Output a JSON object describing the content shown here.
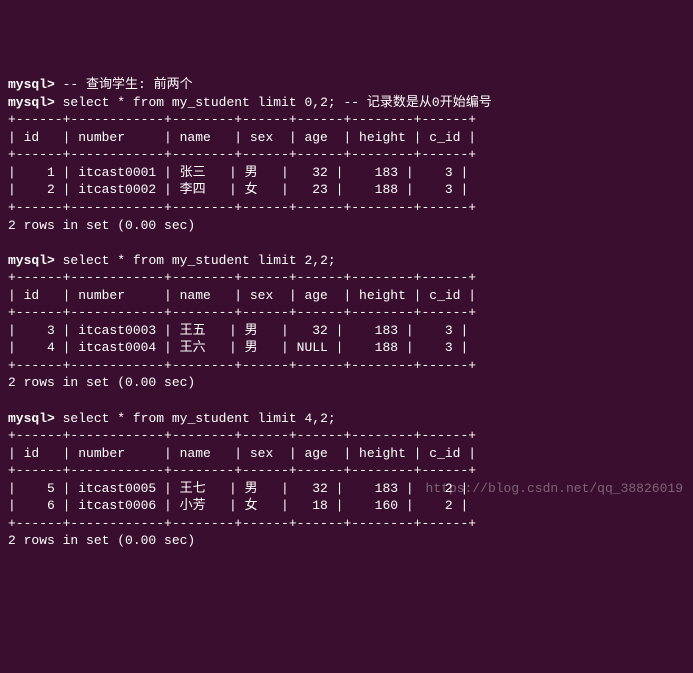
{
  "prompt": "mysql>",
  "block1": {
    "comment_line": "-- 查询学生: 前两个",
    "query": "select * from my_student limit 0,2;",
    "inline_comment": "-- 记录数是从0开始编号",
    "separator": "+------+------------+--------+------+------+--------+------+",
    "header": "| id   | number     | name   | sex  | age  | height | c_id |",
    "rows": [
      "|    1 | itcast0001 | 张三   | 男   |   32 |    183 |    3 |",
      "|    2 | itcast0002 | 李四   | 女   |   23 |    188 |    3 |"
    ],
    "status": "2 rows in set (0.00 sec)"
  },
  "block2": {
    "query": "select * from my_student limit 2,2;",
    "separator": "+------+------------+--------+------+------+--------+------+",
    "header": "| id   | number     | name   | sex  | age  | height | c_id |",
    "rows": [
      "|    3 | itcast0003 | 王五   | 男   |   32 |    183 |    3 |",
      "|    4 | itcast0004 | 王六   | 男   | NULL |    188 |    3 |"
    ],
    "status": "2 rows in set (0.00 sec)"
  },
  "block3": {
    "query": "select * from my_student limit 4,2;",
    "separator": "+------+------------+--------+------+------+--------+------+",
    "header": "| id   | number     | name   | sex  | age  | height | c_id |",
    "rows": [
      "|    5 | itcast0005 | 王七   | 男   |   32 |    183 |    2 |",
      "|    6 | itcast0006 | 小芳   | 女   |   18 |    160 |    2 |"
    ],
    "status": "2 rows in set (0.00 sec)"
  },
  "watermark": "https://blog.csdn.net/qq_38826019",
  "chart_data": {
    "type": "table",
    "columns": [
      "id",
      "number",
      "name",
      "sex",
      "age",
      "height",
      "c_id"
    ],
    "rows": [
      [
        1,
        "itcast0001",
        "张三",
        "男",
        32,
        183,
        3
      ],
      [
        2,
        "itcast0002",
        "李四",
        "女",
        23,
        188,
        3
      ],
      [
        3,
        "itcast0003",
        "王五",
        "男",
        32,
        183,
        3
      ],
      [
        4,
        "itcast0004",
        "王六",
        "男",
        null,
        188,
        3
      ],
      [
        5,
        "itcast0005",
        "王七",
        "男",
        32,
        183,
        2
      ],
      [
        6,
        "itcast0006",
        "小芳",
        "女",
        18,
        160,
        2
      ]
    ]
  }
}
